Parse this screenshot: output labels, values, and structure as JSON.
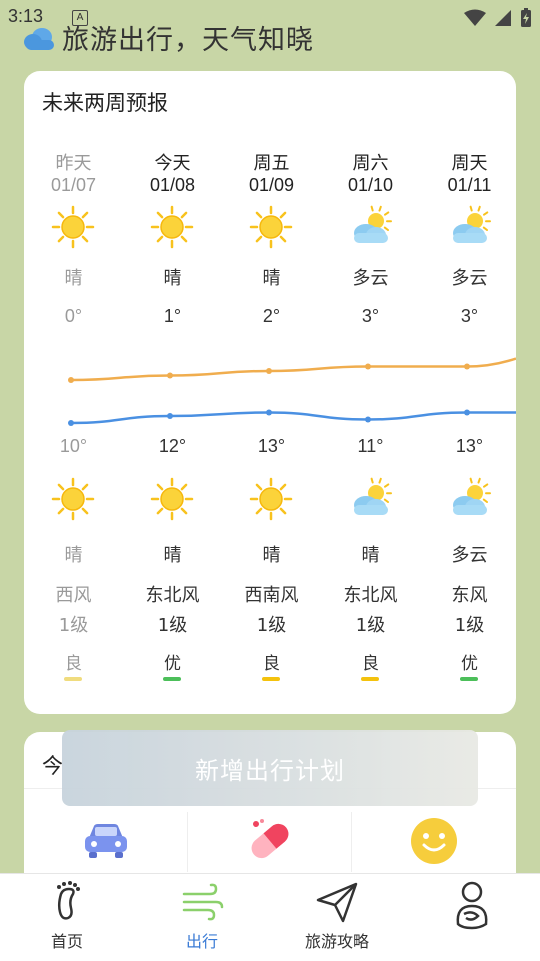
{
  "status": {
    "time": "3:13",
    "notification": "A"
  },
  "header": {
    "title": "旅游出行，天气知晓"
  },
  "forecast": {
    "title": "未来两周预报",
    "days": [
      {
        "day": "昨天",
        "date": "01/07",
        "weather_day": "晴",
        "high": "0°",
        "low": "10°",
        "weather_night": "晴",
        "wind_dir": "西风",
        "wind_level": "1级",
        "aqi": "良",
        "aqi_color": "#f0dc7e",
        "icon_day": "sun-icon",
        "icon_night": "sun-icon",
        "past": true
      },
      {
        "day": "今天",
        "date": "01/08",
        "weather_day": "晴",
        "high": "1°",
        "low": "12°",
        "weather_night": "晴",
        "wind_dir": "东北风",
        "wind_level": "1级",
        "aqi": "优",
        "aqi_color": "#4cbf5a",
        "icon_day": "sun-icon",
        "icon_night": "sun-icon",
        "past": false
      },
      {
        "day": "周五",
        "date": "01/09",
        "weather_day": "晴",
        "high": "2°",
        "low": "13°",
        "weather_night": "晴",
        "wind_dir": "西南风",
        "wind_level": "1级",
        "aqi": "良",
        "aqi_color": "#f4c20d",
        "icon_day": "sun-icon",
        "icon_night": "sun-icon",
        "past": false
      },
      {
        "day": "周六",
        "date": "01/10",
        "weather_day": "多云",
        "high": "3°",
        "low": "11°",
        "weather_night": "晴",
        "wind_dir": "东北风",
        "wind_level": "1级",
        "aqi": "良",
        "aqi_color": "#f4c20d",
        "icon_day": "partly-cloudy-icon",
        "icon_night": "partly-cloudy-icon",
        "past": false
      },
      {
        "day": "周天",
        "date": "01/11",
        "weather_day": "多云",
        "high": "3°",
        "low": "13°",
        "weather_night": "多云",
        "wind_dir": "东风",
        "wind_level": "1级",
        "aqi": "优",
        "aqi_color": "#4cbf5a",
        "icon_day": "partly-cloudy-icon",
        "icon_night": "partly-cloudy-icon",
        "past": false
      }
    ],
    "line_colors": {
      "upper": "#f0ad4e",
      "lower": "#4a90e2"
    }
  },
  "plan": {
    "title": "今",
    "toast": "新增出行计划",
    "icons": [
      "car-icon",
      "pill-icon",
      "smile-icon"
    ]
  },
  "nav": {
    "items": [
      {
        "label": "首页",
        "icon": "footprint-icon"
      },
      {
        "label": "出行",
        "icon": "wind-icon",
        "active": true
      },
      {
        "label": "旅游攻略",
        "icon": "send-icon"
      },
      {
        "label": "",
        "icon": "profile-icon"
      }
    ]
  }
}
